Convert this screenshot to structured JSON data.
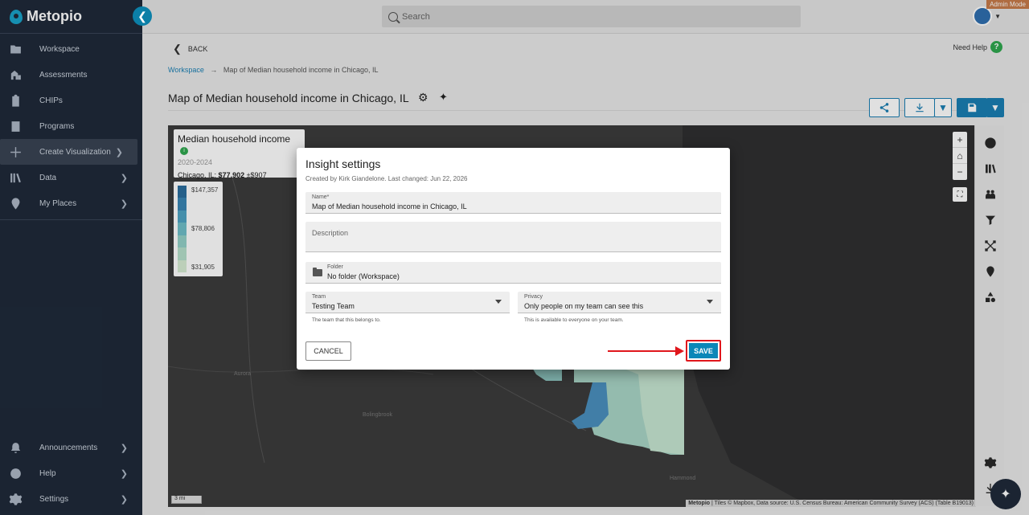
{
  "app": {
    "name": "Metopio",
    "admin_badge": "Admin Mode"
  },
  "sidebar": {
    "items": [
      {
        "label": "Workspace",
        "icon": "folder-icon"
      },
      {
        "label": "Assessments",
        "icon": "assessment-icon"
      },
      {
        "label": "CHIPs",
        "icon": "clipboard-icon"
      },
      {
        "label": "Programs",
        "icon": "programs-icon"
      },
      {
        "label": "Create Visualization",
        "icon": "plus-icon",
        "active": true,
        "chevron": true
      },
      {
        "label": "Data",
        "icon": "library-icon",
        "chevron": true
      },
      {
        "label": "My Places",
        "icon": "location-pin-icon",
        "chevron": true
      }
    ],
    "bottom_items": [
      {
        "label": "Announcements",
        "icon": "bell-icon"
      },
      {
        "label": "Help",
        "icon": "help-icon"
      },
      {
        "label": "Settings",
        "icon": "gear-icon"
      }
    ]
  },
  "topbar": {
    "search_placeholder": "Search"
  },
  "page": {
    "back_label": "BACK",
    "need_help": "Need Help",
    "breadcrumb": {
      "root": "Workspace",
      "current": "Map of Median household income in Chicago, IL"
    },
    "title": "Map of Median household income in Chicago, IL"
  },
  "map": {
    "legend": {
      "title": "Median household income",
      "years": "2020-2024",
      "place": "Chicago, IL:",
      "value": "$77,902",
      "moe": "±$907",
      "scale_labels": [
        "$147,357",
        "$78,806",
        "$31,905"
      ],
      "scale_colors": [
        "#2b6e9e",
        "#3a86b4",
        "#4fa3c3",
        "#6fbfc9",
        "#93d1c8",
        "#b6e0cb",
        "#d6ecd3"
      ]
    },
    "scale_bar": "3 mi",
    "attribution_brand": "Metopio",
    "attribution": "| Tiles © Mapbox, Data source: U.S. Census Bureau: American Community Survey (ACS) (Table B19013)",
    "place_labels": [
      "Aurora",
      "Bolingbrook",
      "Hammond"
    ]
  },
  "modal": {
    "title": "Insight settings",
    "meta": "Created by Kirk Giandelone. Last changed: Jun 22, 2026",
    "name_label": "Name*",
    "name_value": "Map of Median household income in Chicago, IL",
    "description_label": "Description",
    "folder_label": "Folder",
    "folder_value": "No folder (Workspace)",
    "team_label": "Team",
    "team_value": "Testing Team",
    "team_helper": "The team that this belongs to.",
    "privacy_label": "Privacy",
    "privacy_value": "Only people on my team can see this",
    "privacy_helper": "This is available to everyone on your team.",
    "cancel_label": "CANCEL",
    "save_label": "SAVE"
  },
  "colors": {
    "accent": "#1a7fb3",
    "sidebar_bg": "#1f2a3a",
    "highlight": "#e0161c"
  }
}
